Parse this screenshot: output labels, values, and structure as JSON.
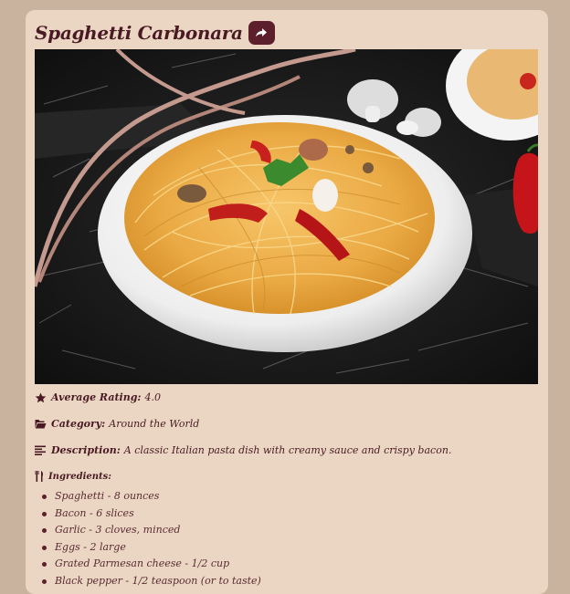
{
  "recipe": {
    "title": "Spaghetti Carbonara",
    "share_icon": "share-icon",
    "rating_label": "Average Rating:",
    "rating_value": "4.0",
    "category_label": "Category:",
    "category_value": "Around the World",
    "description_label": "Description:",
    "description_value": "A classic Italian pasta dish with creamy sauce and crispy bacon.",
    "ingredients_label": "Ingredients:",
    "ingredients": [
      "Spaghetti - 8 ounces",
      "Bacon - 6 slices",
      "Garlic - 3 cloves, minced",
      "Eggs - 2 large",
      "Grated Parmesan cheese - 1/2 cup",
      "Black pepper - 1/2 teaspoon (or to taste)"
    ]
  },
  "colors": {
    "accent": "#5c1f2b",
    "card": "#ead6c2",
    "background": "#c9b39e"
  }
}
